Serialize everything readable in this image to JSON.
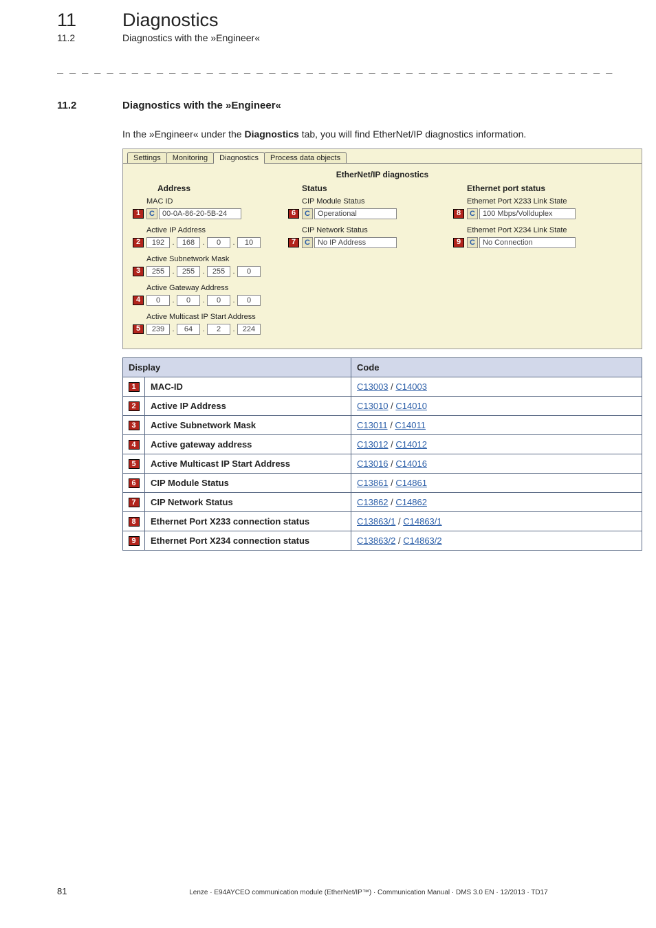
{
  "header": {
    "chapter_num": "11",
    "chapter_title": "Diagnostics",
    "sub_num": "11.2",
    "sub_title": "Diagnostics with the »Engineer«"
  },
  "section": {
    "num": "11.2",
    "title": "Diagnostics with the »Engineer«"
  },
  "intro_pre": "In the »Engineer« under the ",
  "intro_bold": "Diagnostics",
  "intro_post": " tab, you will find EtherNet/IP diagnostics information.",
  "screenshot": {
    "tabs": [
      "Settings",
      "Monitoring",
      "Diagnostics",
      "Process data objects"
    ],
    "selected_tab_index": 2,
    "panel_title": "EtherNet/IP diagnostics",
    "address": {
      "header": "Address",
      "mac_id_label": "MAC ID",
      "mac_id_value": "00-0A-86-20-5B-24",
      "active_ip_label": "Active IP Address",
      "active_ip_value": [
        "192",
        "168",
        "0",
        "10"
      ],
      "subnet_label": "Active Subnetwork Mask",
      "subnet_value": [
        "255",
        "255",
        "255",
        "0"
      ],
      "gateway_label": "Active Gateway Address",
      "gateway_value": [
        "0",
        "0",
        "0",
        "0"
      ],
      "multicast_label": "Active Multicast IP Start Address",
      "multicast_value": [
        "239",
        "64",
        "2",
        "224"
      ]
    },
    "status": {
      "header": "Status",
      "module_label": "CIP Module Status",
      "module_value": "Operational",
      "network_label": "CIP Network Status",
      "network_value": "No IP Address"
    },
    "port": {
      "header": "Ethernet port status",
      "x233_label": "Ethernet Port X233 Link State",
      "x233_value": "100 Mbps/Vollduplex",
      "x234_label": "Ethernet Port X234 Link State",
      "x234_value": "No Connection"
    },
    "c_label": "C"
  },
  "table": {
    "headers": {
      "display": "Display",
      "code": "Code"
    },
    "rows": [
      {
        "n": "1",
        "display": "MAC-ID",
        "code_a": "C13003",
        "code_b": "C14003"
      },
      {
        "n": "2",
        "display": "Active IP Address",
        "code_a": "C13010",
        "code_b": "C14010"
      },
      {
        "n": "3",
        "display": "Active Subnetwork Mask",
        "code_a": "C13011",
        "code_b": "C14011"
      },
      {
        "n": "4",
        "display": "Active gateway address",
        "code_a": "C13012",
        "code_b": "C14012"
      },
      {
        "n": "5",
        "display": "Active Multicast IP Start Address",
        "code_a": "C13016",
        "code_b": "C14016"
      },
      {
        "n": "6",
        "display": "CIP Module Status",
        "code_a": "C13861",
        "code_b": "C14861"
      },
      {
        "n": "7",
        "display": "CIP Network Status",
        "code_a": "C13862",
        "code_b": "C14862"
      },
      {
        "n": "8",
        "display": "Ethernet Port X233 connection status",
        "code_a": "C13863/1",
        "code_b": "C14863/1"
      },
      {
        "n": "9",
        "display": "Ethernet Port X234 connection status",
        "code_a": "C13863/2",
        "code_b": "C14863/2"
      }
    ]
  },
  "footer": {
    "page": "81",
    "text": "Lenze · E94AYCEO communication module (EtherNet/IP™) · Communication Manual · DMS 3.0 EN · 12/2013 · TD17"
  }
}
